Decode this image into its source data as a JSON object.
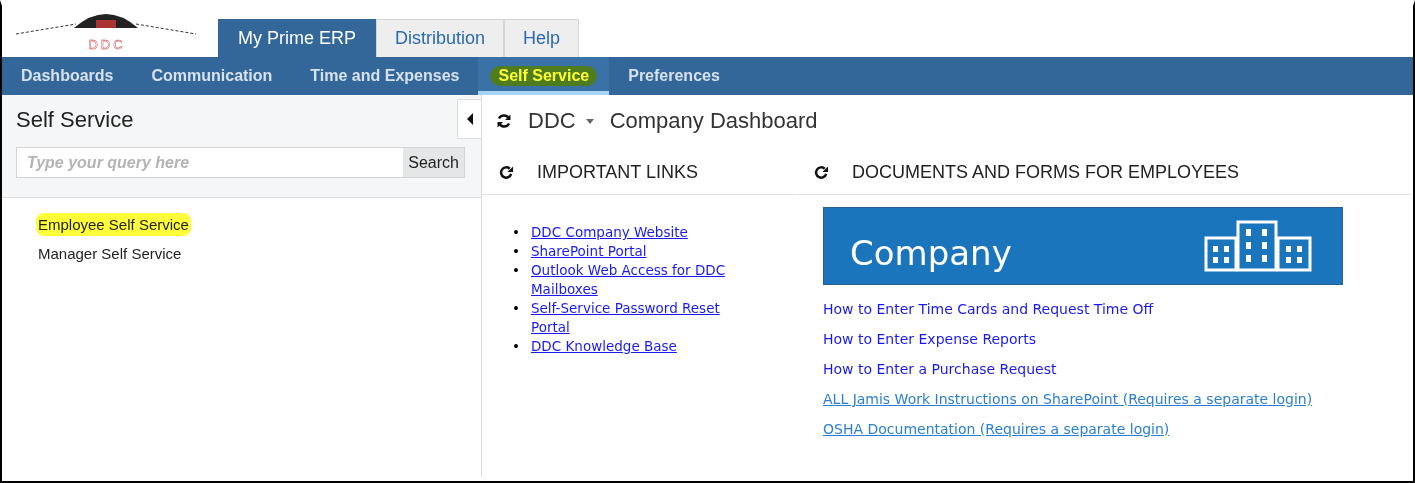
{
  "logo": {
    "text": "DDC"
  },
  "top_tabs": [
    {
      "label": "My Prime ERP",
      "selected": true
    },
    {
      "label": "Distribution",
      "selected": false
    },
    {
      "label": "Help",
      "selected": false
    }
  ],
  "nav": [
    {
      "label": "Dashboards",
      "selected": false
    },
    {
      "label": "Communication",
      "selected": false
    },
    {
      "label": "Time and Expenses",
      "selected": false
    },
    {
      "label": "Self Service",
      "selected": true
    },
    {
      "label": "Preferences",
      "selected": false
    }
  ],
  "sidebar": {
    "title": "Self Service",
    "search": {
      "placeholder": "Type your query here",
      "button": "Search"
    },
    "items": [
      {
        "label": "Employee Self Service",
        "highlighted": true
      },
      {
        "label": "Manager Self Service",
        "highlighted": false
      }
    ]
  },
  "dashboard": {
    "company": "DDC",
    "title": "Company Dashboard",
    "important_links": {
      "title": "IMPORTANT LINKS",
      "bullet": "•",
      "links": [
        "DDC Company Website",
        "SharePoint Portal",
        "Outlook Web Access for DDC Mailboxes",
        "Self-Service Password Reset Portal",
        "DDC Knowledge Base"
      ]
    },
    "documents": {
      "title": "DOCUMENTS AND FORMS FOR EMPLOYEES",
      "banner": "Company",
      "links": [
        {
          "label": "How to Enter Time Cards and Request Time Off",
          "kind": "plain"
        },
        {
          "label": "How to Enter Expense Reports",
          "kind": "plain"
        },
        {
          "label": "How to Enter a Purchase Request",
          "kind": "plain"
        },
        {
          "label": "ALL Jamis Work Instructions on SharePoint (Requires a separate login)",
          "kind": "underlined"
        },
        {
          "label": "OSHA Documentation (Requires a separate login)",
          "kind": "underlined"
        }
      ]
    }
  }
}
